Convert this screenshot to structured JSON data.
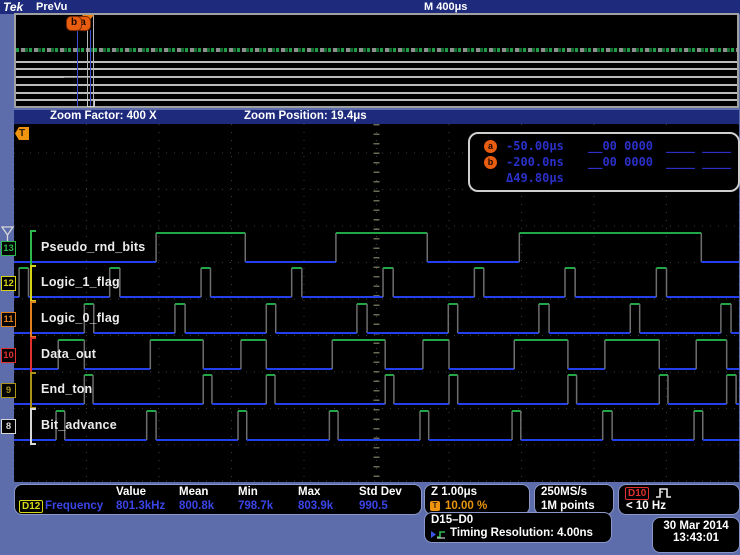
{
  "header": {
    "logo": "Tek",
    "mode": "PreVu",
    "timebase": "M 400μs"
  },
  "zoom_bar": {
    "factor": "Zoom Factor: 400 X",
    "position": "Zoom Position: 19.4μs"
  },
  "overview": {
    "cursor_a_label": "a",
    "cursor_b_label": "b"
  },
  "trigger_flag_label": "T",
  "cursors": {
    "a_label": "a",
    "a_time": "-50.00μs",
    "a_value": "__00 0000",
    "a_bits": "____ ____",
    "b_label": "b",
    "b_time": "-200.0ns",
    "b_value": "__00 0000",
    "b_bits": "____ ____",
    "delta": "Δ49.80μs"
  },
  "chart_data": {
    "type": "digital-timing",
    "x_unit": "μs",
    "x_range": [
      0,
      10
    ],
    "time_per_div": "1.00μs",
    "grid": {
      "h_divs": 10,
      "v_rows": 10,
      "style": "dotted"
    },
    "channels": [
      {
        "name": "Pseudo_rnd_bits",
        "bit": "13",
        "color": "#2db84d",
        "initial": 0,
        "toggles_us": [
          1.96,
          3.19,
          4.44,
          5.7,
          6.97,
          9.48
        ]
      },
      {
        "name": "Logic_1_flag",
        "bit": "12",
        "color": "#d4d415",
        "initial": 0,
        "toggles_us": [
          0.07,
          0.2,
          1.32,
          1.46,
          2.58,
          2.71,
          3.83,
          3.97,
          5.09,
          5.23,
          6.35,
          6.48,
          7.6,
          7.74,
          8.86,
          9.0
        ]
      },
      {
        "name": "Logic_0_flag",
        "bit": "11",
        "color": "#e0801f",
        "initial": 0,
        "toggles_us": [
          0.97,
          1.1,
          2.22,
          2.36,
          3.48,
          3.61,
          4.73,
          4.87,
          5.99,
          6.12,
          7.24,
          7.38,
          8.5,
          8.63,
          9.75,
          9.89
        ]
      },
      {
        "name": "Data_out",
        "bit": "10",
        "color": "#e03030",
        "initial": 0,
        "toggles_us": [
          0.61,
          0.97,
          1.88,
          2.61,
          3.13,
          3.48,
          4.39,
          5.12,
          5.64,
          6.0,
          6.9,
          7.64,
          8.15,
          8.9,
          9.41,
          9.83
        ]
      },
      {
        "name": "End_ton",
        "bit": "9",
        "color": "#ad9418",
        "initial": 0,
        "toggles_us": [
          0.97,
          1.09,
          2.61,
          2.73,
          3.48,
          3.6,
          5.12,
          5.24,
          6.0,
          6.12,
          7.64,
          7.76,
          8.9,
          9.02,
          9.83,
          9.96
        ]
      },
      {
        "name": "Bit_advance",
        "bit": "8",
        "color": "#d8d8d8",
        "initial": 0,
        "toggles_us": [
          0.58,
          0.7,
          1.83,
          1.96,
          3.09,
          3.21,
          4.35,
          4.47,
          5.6,
          5.72,
          6.87,
          6.99,
          8.12,
          8.25,
          9.38,
          9.5
        ]
      }
    ],
    "trace_colors": {
      "high": "#1fa845",
      "low": "#2440ee",
      "edge": "#6e6e6e"
    }
  },
  "measurement": {
    "headers": [
      "Value",
      "Mean",
      "Min",
      "Max",
      "Std Dev"
    ],
    "source": "D12",
    "name": "Frequency",
    "value": "801.3kHz",
    "mean": "800.8k",
    "min": "798.7k",
    "max": "803.9k",
    "std_dev": "990.5"
  },
  "info": {
    "zoom_scale": "Z 1.00μs",
    "zoom_icon_label": "T",
    "zoom_pct": "10.00 %",
    "sample_rate": "250MS/s",
    "record_length": "1M points",
    "trig_source": "D10",
    "trig_freq": "< 10 Hz",
    "bus": "D15–D0",
    "timing_res": "Timing Resolution: 4.00ns",
    "date": "30 Mar 2014",
    "time": "13:43:01"
  }
}
